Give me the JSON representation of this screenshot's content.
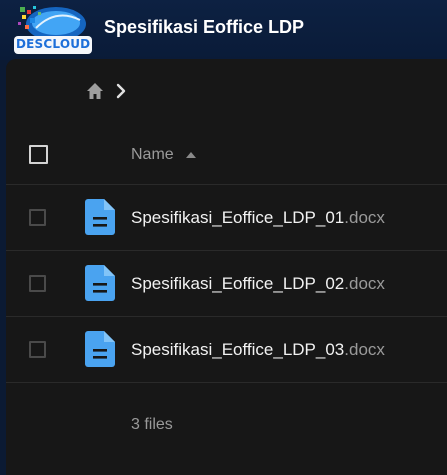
{
  "header": {
    "logo": {
      "text_left": "DES",
      "text_right": "CLOUD",
      "icon": "descloud-logo-icon"
    },
    "title": "Spesifikasi Eoffice LDP"
  },
  "breadcrumb": {
    "home_icon": "home-icon",
    "separator_icon": "chevron-right-icon"
  },
  "table": {
    "column_name_label": "Name",
    "sort_icon": "sort-ascending-icon",
    "files": [
      {
        "name": "Spesifikasi_Eoffice_LDP_01",
        "ext": ".docx",
        "icon": "document-icon"
      },
      {
        "name": "Spesifikasi_Eoffice_LDP_02",
        "ext": ".docx",
        "icon": "document-icon"
      },
      {
        "name": "Spesifikasi_Eoffice_LDP_03",
        "ext": ".docx",
        "icon": "document-icon"
      }
    ],
    "summary": "3 files"
  },
  "colors": {
    "header_bg": "#0b1a33",
    "panel_bg": "#171717",
    "file_icon": "#4aa3f0",
    "muted_text": "#9a9a9a"
  }
}
